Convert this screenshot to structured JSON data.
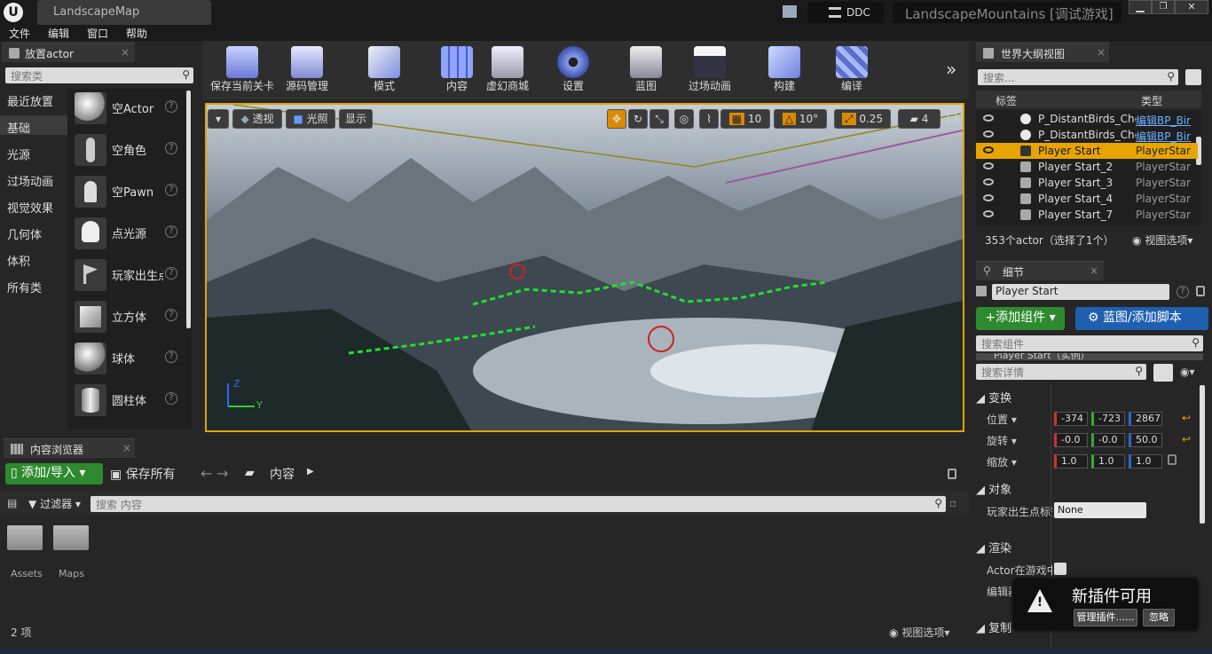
{
  "window": {
    "tab_title": "LandscapeMap",
    "project": "LandscapeMountains [调试游戏]",
    "ddc": "DDC"
  },
  "menu": [
    "文件",
    "编辑",
    "窗口",
    "帮助"
  ],
  "place_actor": {
    "tab": "放置actor",
    "search_placeholder": "搜索类",
    "categories": [
      "最近放置",
      "基础",
      "光源",
      "过场动画",
      "视觉效果",
      "几何体",
      "体积",
      "所有类"
    ],
    "selected_category": "基础",
    "actors": [
      "空Actor",
      "空角色",
      "空Pawn",
      "点光源",
      "玩家出生点",
      "立方体",
      "球体",
      "圆柱体"
    ]
  },
  "toolbar": [
    "保存当前关卡",
    "源码管理",
    "模式",
    "内容",
    "虚幻商城",
    "设置",
    "蓝图",
    "过场动画",
    "构建",
    "编译"
  ],
  "viewport": {
    "view_mode": "透视",
    "lighting": "光照",
    "show": "显示",
    "grid_snap": "10",
    "rot_snap": "10°",
    "scale_snap": "0.25",
    "camera_speed": "4",
    "axis_z": "Z",
    "axis_y": "Y"
  },
  "outliner": {
    "tab": "世界大纲视图",
    "search_placeholder": "搜索...",
    "col_label": "标签",
    "col_type": "类型",
    "rows": [
      {
        "name": "P_DistantBirds_Cheap",
        "type": "编辑BP_Birds",
        "selected": false
      },
      {
        "name": "P_DistantBirds_Cheap",
        "type": "编辑BP_Birds",
        "selected": false
      },
      {
        "name": "Player Start",
        "type": "PlayerStart",
        "selected": true
      },
      {
        "name": "Player Start_2",
        "type": "PlayerStart",
        "selected": false
      },
      {
        "name": "Player Start_3",
        "type": "PlayerStart",
        "selected": false
      },
      {
        "name": "Player Start_4",
        "type": "PlayerStart",
        "selected": false
      },
      {
        "name": "Player Start_7",
        "type": "PlayerStart",
        "selected": false
      }
    ],
    "status": "353个actor（选择了1个）",
    "view_options": "视图选项"
  },
  "details": {
    "tab": "细节",
    "actor_name": "Player Start",
    "add_component": "+添加组件",
    "blueprint": "蓝图/添加脚本",
    "search_components": "搜索组件",
    "component_partial": "Player Start（实例）",
    "search_details": "搜索详情",
    "sections": {
      "transform": "变换",
      "object": "对象",
      "rendering": "渲染",
      "replication": "复制"
    },
    "location_label": "位置",
    "rotation_label": "旋转",
    "scale_label": "缩放",
    "location": [
      "-374",
      "-723",
      "2867"
    ],
    "rotation": [
      "-0.0",
      "-0.0",
      "50.0"
    ],
    "scale": [
      "1.0",
      "1.0",
      "1.0"
    ],
    "player_start_tag_label": "玩家出生点标签",
    "player_start_tag_value": "None",
    "actor_hidden_label": "Actor在游戏中隐藏",
    "editor_label": "编辑器"
  },
  "content_browser": {
    "tab": "内容浏览器",
    "add_import": "添加/导入",
    "save_all": "保存所有",
    "path": "内容",
    "filter": "过滤器",
    "search_placeholder": "搜索 内容",
    "folders": [
      "Assets",
      "Maps"
    ],
    "count": "2 项",
    "view_options": "视图选项"
  },
  "toast": {
    "title": "新插件可用",
    "manage": "管理插件......",
    "dismiss": "忽略"
  }
}
